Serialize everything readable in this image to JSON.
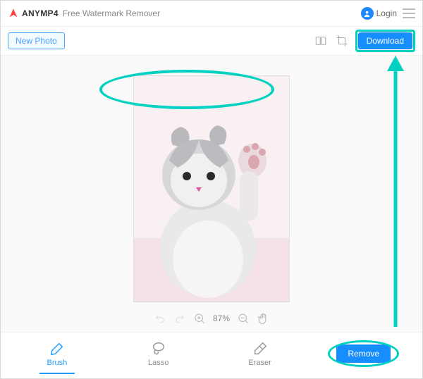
{
  "brand": {
    "name": "ANYMP4",
    "product": "Free Watermark Remover"
  },
  "header": {
    "login": "Login"
  },
  "toolbar": {
    "new_photo": "New Photo",
    "download": "Download"
  },
  "zoom": {
    "value": "87%"
  },
  "tools": {
    "brush": "Brush",
    "lasso": "Lasso",
    "eraser": "Eraser",
    "remove": "Remove"
  },
  "colors": {
    "accent": "#168eff",
    "highlight": "#00d1c1"
  }
}
